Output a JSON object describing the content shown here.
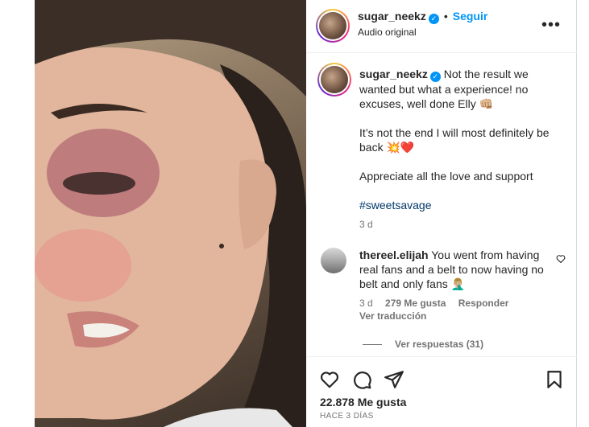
{
  "post": {
    "username": "sugar_neekz",
    "verified_mark": "✓",
    "separator": "•",
    "follow_label": "Seguir",
    "audio_label": "Audio original",
    "more_label": "•••"
  },
  "caption": {
    "username": "sugar_neekz",
    "paragraphs": [
      "Not the result we wanted but what a experience! no excuses, well done Elly 👊🏼",
      "It’s not the end I will most definitely be back 💥❤️",
      "Appreciate all the love and support"
    ],
    "hashtag": "#sweetsavage",
    "age": "3 d"
  },
  "comment": {
    "username": "thereel.elijah",
    "text": "You went from having real fans and a belt to now having no belt and only fans 🤦🏼‍♂️",
    "age": "3 d",
    "likes": "279 Me gusta",
    "reply_label": "Responder",
    "translate_label": "Ver traducción",
    "view_replies_label": "Ver respuestas (31)"
  },
  "footer": {
    "likes": "22.878 Me gusta",
    "date": "HACE 3 DÍAS"
  },
  "icons": [
    "heart-icon",
    "comment-icon",
    "share-icon",
    "bookmark-icon",
    "verified-icon",
    "more-icon"
  ]
}
